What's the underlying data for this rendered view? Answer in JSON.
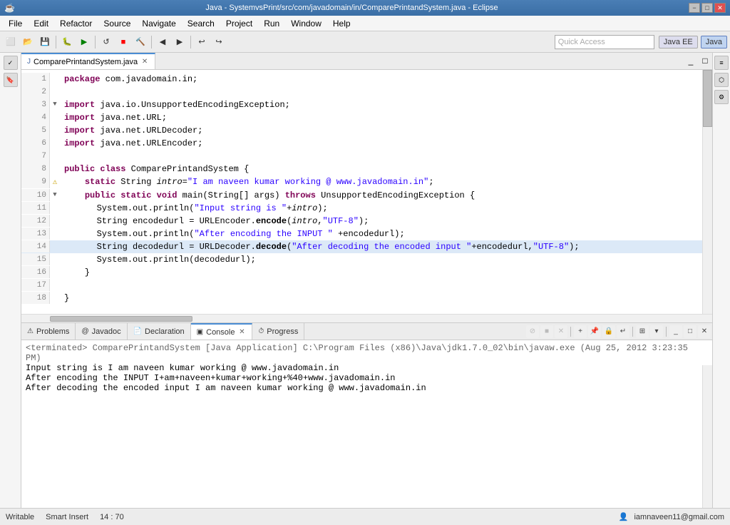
{
  "titleBar": {
    "title": "Java - SystemvsPrint/src/com/javadomain/in/ComparePrintandSystem.java - Eclipse",
    "minimize": "−",
    "maximize": "□",
    "close": "✕"
  },
  "menuBar": {
    "items": [
      "File",
      "Edit",
      "Refactor",
      "Source",
      "Navigate",
      "Search",
      "Project",
      "Run",
      "Window",
      "Help"
    ]
  },
  "toolbar": {
    "quickAccessPlaceholder": "Quick Access",
    "perspectives": [
      "Java EE",
      "Java"
    ]
  },
  "editorTab": {
    "icon": "J",
    "label": "ComparePrintandSystem.java",
    "closeBtn": "✕"
  },
  "code": {
    "packageLine": "package com.javadomain.in;",
    "imports": [
      "import java.io.UnsupportedEncodingException;",
      "import java.net.URL;",
      "import java.net.URLDecoder;",
      "import java.net.URLEncoder;"
    ],
    "classDecl": "public class ComparePrintandSystem {",
    "staticField": "    static String intro=\"I am naveen kumar working @ www.javadomain.in\";",
    "mainDecl": "    public static void main(String[] args) throws UnsupportedEncodingException {",
    "line1": "        System.out.println(\"Input string is \"+intro);",
    "line2": "        String encodedurl = URLEncoder.encode(intro,\"UTF-8\");",
    "line3": "        System.out.println(\"After encoding the INPUT \" +encodedurl);",
    "line4": "        String decodedurl = URLDecoder.decode(\"After decoding the encoded input \"+encodedurl,\"UTF-8\");",
    "line5": "        System.out.println(decodedurl);",
    "closeBrace1": "    }",
    "closeBrace2": "}"
  },
  "bottomTabs": {
    "items": [
      "Problems",
      "Javadoc",
      "Declaration",
      "Console",
      "Progress"
    ],
    "activeTab": "Console",
    "activeTabIndex": 3
  },
  "console": {
    "terminated": "<terminated> ComparePrintandSystem [Java Application] C:\\Program Files (x86)\\Java\\jdk1.7.0_02\\bin\\javaw.exe (Aug 25, 2012 3:23:35 PM)",
    "line1": "Input string is I am naveen kumar working @ www.javadomain.in",
    "line2": "After encoding the INPUT I+am+naveen+kumar+working+%40+www.javadomain.in",
    "line3": "After decoding the encoded input I am naveen kumar working @ www.javadomain.in"
  },
  "statusBar": {
    "writable": "Writable",
    "smartInsert": "Smart Insert",
    "position": "14 : 70",
    "user": "iamnaveen11@gmail.com"
  }
}
